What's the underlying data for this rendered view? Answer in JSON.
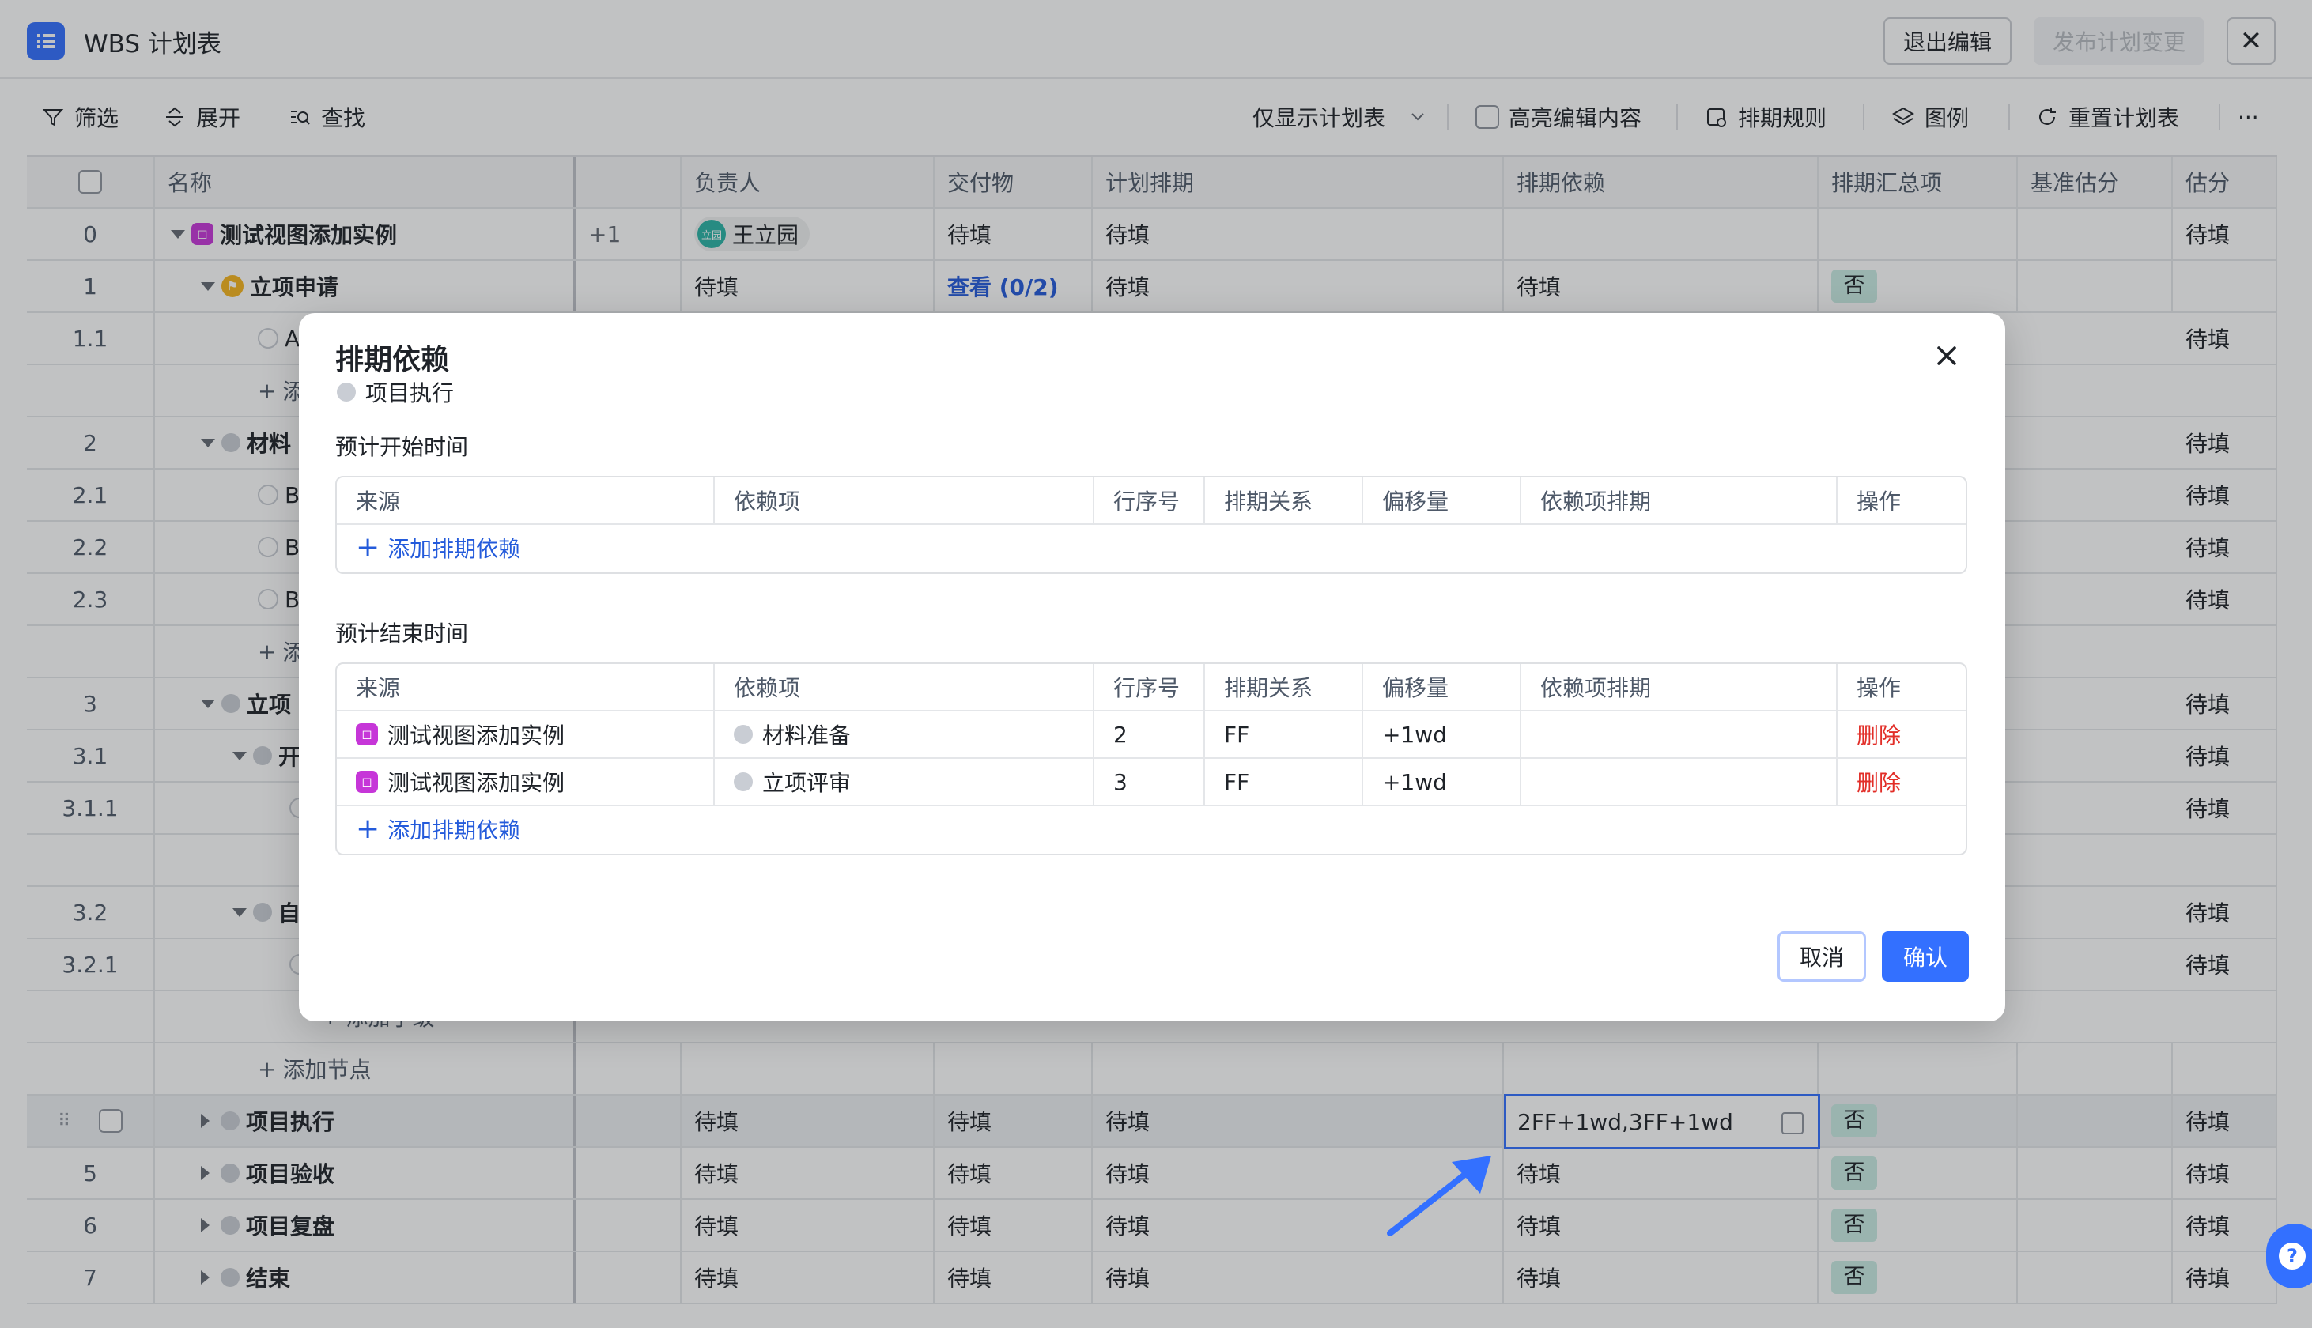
{
  "header": {
    "title": "WBS 计划表",
    "exit_label": "退出编辑",
    "publish_label": "发布计划变更",
    "close_label": "✕"
  },
  "toolbar": {
    "filter": "筛选",
    "expand": "展开",
    "find": "查找",
    "view_select": "仅显示计划表",
    "highlight": "高亮编辑内容",
    "schedule_rules": "排期规则",
    "legend": "图例",
    "reset": "重置计划表",
    "more": "···"
  },
  "table": {
    "columns": {
      "name": "名称",
      "owner": "负责人",
      "deliverable": "交付物",
      "plan": "计划排期",
      "dependency": "排期依赖",
      "summary": "排期汇总项",
      "baseline": "基准估分",
      "estimate": "估分"
    },
    "rows": [
      {
        "idx": "0",
        "name": "测试视图添加实例",
        "extra": "+1",
        "owner": "王立园",
        "owner_avatar": "立园",
        "deliverable": "待填",
        "plan": "待填",
        "dependency": "",
        "summary": "",
        "estimate": "待填"
      },
      {
        "idx": "1",
        "name": "立项申请",
        "owner": "待填",
        "deliverable": "查看 (0/2)",
        "plan": "待填",
        "dependency": "待填",
        "summary": "否",
        "estimate": ""
      },
      {
        "idx": "1.1",
        "name": "A",
        "estimate": "待填"
      },
      {
        "idx": "",
        "name": "添",
        "estimate": ""
      },
      {
        "idx": "2",
        "name": "材料",
        "estimate": "待填"
      },
      {
        "idx": "2.1",
        "name": "B",
        "estimate": "待填"
      },
      {
        "idx": "2.2",
        "name": "B",
        "estimate": "待填"
      },
      {
        "idx": "2.3",
        "name": "B",
        "estimate": "待填"
      },
      {
        "idx": "",
        "name": "添",
        "estimate": ""
      },
      {
        "idx": "3",
        "name": "立项",
        "estimate": "待填"
      },
      {
        "idx": "3.1",
        "name": "开",
        "estimate": "待填"
      },
      {
        "idx": "3.1.1",
        "name": "",
        "estimate": "待填"
      },
      {
        "idx": "",
        "name": "",
        "estimate": ""
      },
      {
        "idx": "3.2",
        "name": "自",
        "estimate": "待填"
      },
      {
        "idx": "3.2.1",
        "name": "",
        "estimate": "待填"
      },
      {
        "idx": "",
        "name": "添加子级",
        "estimate": ""
      },
      {
        "idx": "",
        "name": "添加节点",
        "estimate": ""
      },
      {
        "idx": "",
        "name": "项目执行",
        "owner": "待填",
        "deliverable": "待填",
        "plan": "待填",
        "dependency": "2FF+1wd,3FF+1wd",
        "summary": "否",
        "estimate": "待填"
      },
      {
        "idx": "5",
        "name": "项目验收",
        "owner": "待填",
        "deliverable": "待填",
        "plan": "待填",
        "dependency": "待填",
        "summary": "否",
        "estimate": "待填"
      },
      {
        "idx": "6",
        "name": "项目复盘",
        "owner": "待填",
        "deliverable": "待填",
        "plan": "待填",
        "dependency": "待填",
        "summary": "否",
        "estimate": "待填"
      },
      {
        "idx": "7",
        "name": "结束",
        "owner": "待填",
        "deliverable": "待填",
        "plan": "待填",
        "dependency": "待填",
        "summary": "否",
        "estimate": "待填"
      }
    ]
  },
  "modal": {
    "title": "排期依赖",
    "subtitle": "项目执行",
    "start_section": "预计开始时间",
    "end_section": "预计结束时间",
    "columns": [
      "来源",
      "依赖项",
      "行序号",
      "排期关系",
      "偏移量",
      "依赖项排期",
      "操作"
    ],
    "add_label": "添加排期依赖",
    "end_rows": [
      {
        "source": "测试视图添加实例",
        "item": "材料准备",
        "row_no": "2",
        "relation": "FF",
        "offset": "+1wd",
        "item_schedule": "",
        "action": "删除"
      },
      {
        "source": "测试视图添加实例",
        "item": "立项评审",
        "row_no": "3",
        "relation": "FF",
        "offset": "+1wd",
        "item_schedule": "",
        "action": "删除"
      }
    ],
    "cancel_label": "取消",
    "confirm_label": "确认"
  },
  "colors": {
    "accent": "#3370ff",
    "danger": "#e22e28",
    "badge_bg": "#c9ece4",
    "project_icon": "#c636d8"
  },
  "icons": [
    "list-icon",
    "filter-icon",
    "expand-icon",
    "search-icon",
    "chevron-down-icon",
    "schedule-rule-icon",
    "layers-icon",
    "reset-icon",
    "more-icon",
    "close-icon",
    "plus-icon",
    "help-icon",
    "arrow-icon",
    "drag-handle-icon"
  ]
}
